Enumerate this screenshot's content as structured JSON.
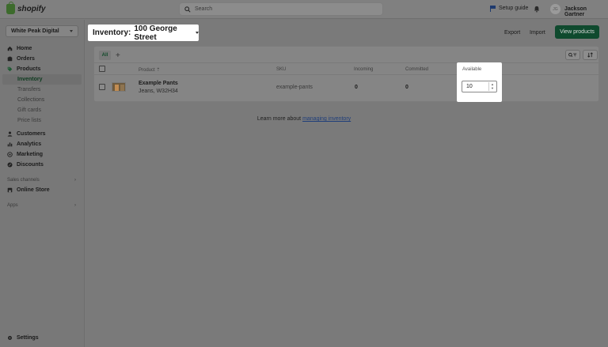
{
  "topbar": {
    "logo_text": "shopify",
    "search_placeholder": "Search",
    "setup_guide": "Setup guide",
    "avatar_initials": "JG",
    "user_name": "Jackson Gartner"
  },
  "sidebar": {
    "store_name": "White Peak Digital",
    "items": [
      {
        "label": "Home",
        "icon": "home-icon"
      },
      {
        "label": "Orders",
        "icon": "orders-icon"
      },
      {
        "label": "Products",
        "icon": "tag-icon"
      }
    ],
    "product_subitems": [
      "Inventory",
      "Transfers",
      "Collections",
      "Gift cards",
      "Price lists"
    ],
    "items2": [
      {
        "label": "Customers",
        "icon": "person-icon"
      },
      {
        "label": "Analytics",
        "icon": "chart-icon"
      },
      {
        "label": "Marketing",
        "icon": "target-icon"
      },
      {
        "label": "Discounts",
        "icon": "discount-icon"
      }
    ],
    "sales_channels_label": "Sales channels",
    "online_store": "Online Store",
    "apps_label": "Apps",
    "settings": "Settings"
  },
  "page": {
    "title": "Inventory:",
    "location": "100 George Street",
    "export": "Export",
    "import": "Import",
    "view_products": "View products"
  },
  "table": {
    "tab_all": "All",
    "add_tab": "+",
    "headers": [
      "Product",
      "SKU",
      "Incoming",
      "Committed",
      "Available"
    ],
    "rows": [
      {
        "name": "Example Pants",
        "variant": "Jeans, W32H34",
        "sku": "example-pants",
        "incoming": "0",
        "committed": "0",
        "available": "10"
      }
    ]
  },
  "footer": {
    "learn_text": "Learn more about",
    "learn_link": "managing inventory"
  },
  "colors": {
    "primary_button": "#0f4a2e",
    "overlay": "#7a7a7a"
  }
}
